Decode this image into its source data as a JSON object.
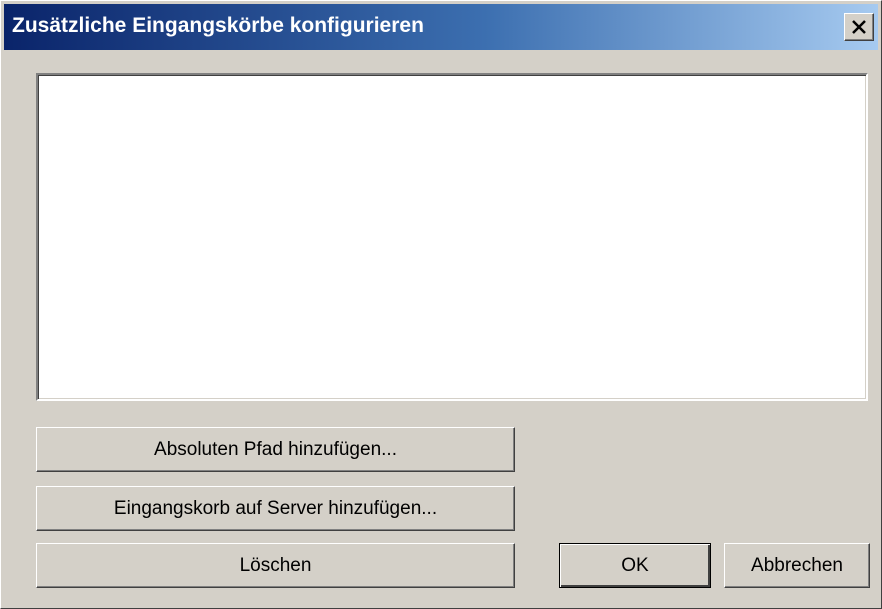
{
  "dialog": {
    "title": "Zusätzliche Eingangskörbe konfigurieren",
    "close_icon": "close-icon"
  },
  "list": {
    "items": []
  },
  "buttons": {
    "add_absolute_path": "Absoluten Pfad hinzufügen...",
    "add_server_inbox": "Eingangskorb auf Server hinzufügen...",
    "delete": "Löschen",
    "ok": "OK",
    "cancel": "Abbrechen"
  },
  "colors": {
    "titlebar_start": "#0a246a",
    "titlebar_end": "#a6caf0",
    "dialog_background": "#d4d0c8",
    "list_background": "#ffffff"
  }
}
